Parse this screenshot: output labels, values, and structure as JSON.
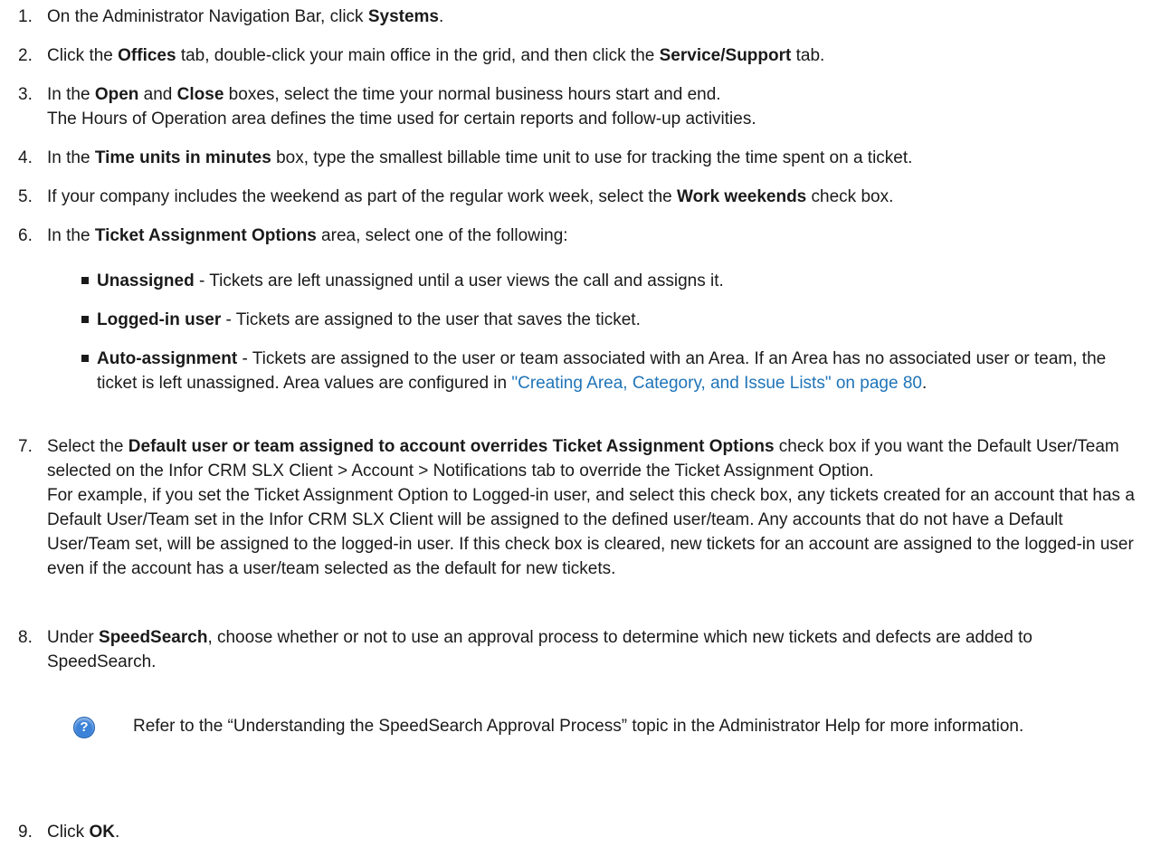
{
  "steps": [
    {
      "num": "1.",
      "t1": "On the Administrator Navigation Bar, click ",
      "b1": "Systems",
      "t2": "."
    },
    {
      "num": "2.",
      "t1": "Click the ",
      "b1": "Offices",
      "t2": " tab, double-click your main office in the grid, and then click the ",
      "b2": "Service/Support",
      "t3": " tab."
    },
    {
      "num": "3.",
      "t1": "In the ",
      "b1": "Open",
      "t2": " and ",
      "b2": "Close",
      "t3": " boxes, select the time your normal business hours start and end.",
      "line2": "The Hours of Operation area defines the time used for certain reports and follow-up activities."
    },
    {
      "num": "4.",
      "t1": "In the ",
      "b1": "Time units in minutes",
      "t2": " box, type the smallest billable time unit to use for tracking the time spent on a ticket."
    },
    {
      "num": "5.",
      "t1": "If your company includes the weekend as part of the regular work week, select the ",
      "b1": "Work weekends",
      "t2": " check box."
    },
    {
      "num": "6.",
      "t1": "In the ",
      "b1": "Ticket Assignment Options",
      "t2": " area, select one of the following:"
    },
    {
      "num": "7.",
      "t1": "Select the ",
      "b1": "Default user or team assigned to account overrides Ticket Assignment Options",
      "t2": " check box if you want the Default User/Team selected on the Infor CRM SLX Client > Account > Notifications tab to override the Ticket Assignment Option.",
      "para2": "For example, if you set the Ticket Assignment Option to Logged-in user, and select this check box, any tickets created for an account that has a Default User/Team set in the Infor CRM SLX Client will be assigned to the defined user/team. Any accounts that do not have a Default User/Team set, will be assigned to the logged-in user. If this check box is cleared, new tickets for an account are assigned to the logged-in user even if the account has a user/team selected as the default for new tickets."
    },
    {
      "num": "8.",
      "t1": "Under ",
      "b1": "SpeedSearch",
      "t2": ", choose whether or not to use an approval process to determine which new tickets and defects are added to SpeedSearch."
    },
    {
      "num": "9.",
      "t1": "Click ",
      "b1": "OK",
      "t2": "."
    }
  ],
  "options": [
    {
      "label": "Unassigned",
      "text": " - Tickets are left unassigned until a user views the call and assigns it."
    },
    {
      "label": "Logged-in user",
      "text": " - Tickets are assigned to the user that saves the ticket."
    },
    {
      "label": "Auto-assignment",
      "text": " - Tickets are assigned to the user or team associated with an Area. If an Area has no associated user or team, the ticket is left unassigned. Area values are configured in ",
      "link": "\"Creating Area, Category, and Issue Lists\" on page 80",
      "end": "."
    }
  ],
  "note": {
    "icon": "help-icon",
    "glyph": "?",
    "text": "Refer to the “Understanding the SpeedSearch Approval Process” topic in the Administrator Help for more information."
  },
  "colors": {
    "link": "#1f74b8",
    "icon": "#3b82d8"
  }
}
